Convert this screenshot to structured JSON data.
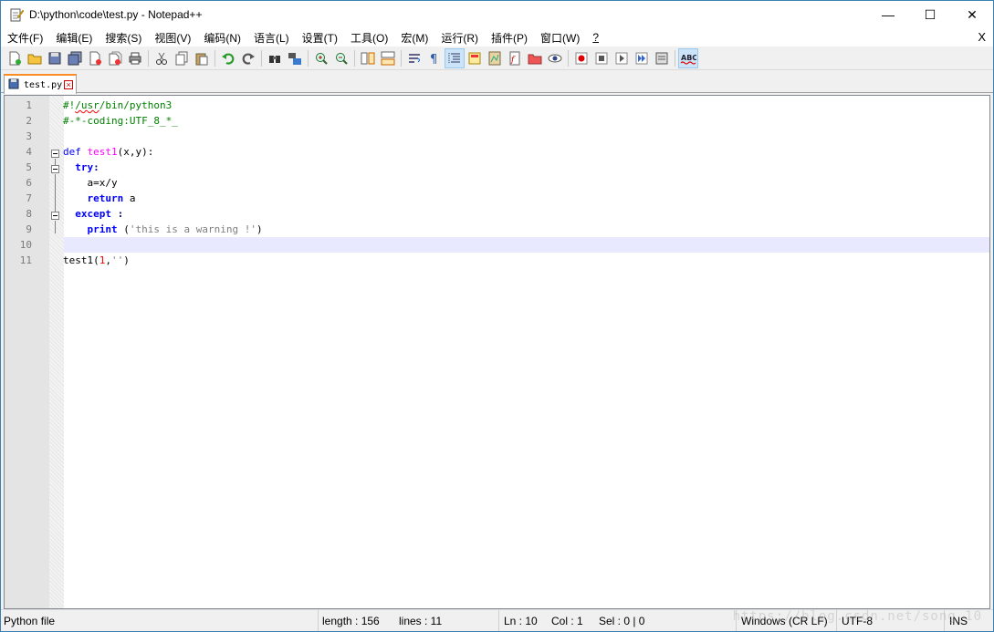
{
  "window": {
    "title": "D:\\python\\code\\test.py - Notepad++",
    "minimize": "—",
    "maximize": "☐",
    "close": "✕"
  },
  "menu": {
    "items": [
      "文件(F)",
      "编辑(E)",
      "搜索(S)",
      "视图(V)",
      "编码(N)",
      "语言(L)",
      "设置(T)",
      "工具(O)",
      "宏(M)",
      "运行(R)",
      "插件(P)",
      "窗口(W)",
      "?"
    ],
    "close_doc": "X"
  },
  "toolbar": {
    "icons": [
      "new-file-icon",
      "open-file-icon",
      "save-icon",
      "save-all-icon",
      "close-icon",
      "close-all-icon",
      "print-icon",
      "cut-icon",
      "copy-icon",
      "paste-icon",
      "undo-icon",
      "redo-icon",
      "find-icon",
      "replace-icon",
      "zoom-in-icon",
      "zoom-out-icon",
      "sync-vertical-icon",
      "sync-horizontal-icon",
      "word-wrap-icon",
      "show-all-chars-icon",
      "indent-guide-icon",
      "user-defined-lang-icon",
      "doc-map-icon",
      "function-list-icon",
      "folder-workspace-icon",
      "monitoring-icon",
      "record-macro-icon",
      "stop-record-icon",
      "playback-macro-icon",
      "run-macro-multiple-icon",
      "save-macro-icon",
      "spell-check-icon"
    ]
  },
  "tab": {
    "label": "test.py",
    "close": "×"
  },
  "editor": {
    "lines": [
      {
        "num": "1",
        "segments": [
          {
            "t": "#!",
            "c": "c-comment"
          },
          {
            "t": "/usr",
            "c": "c-comment squiggle"
          },
          {
            "t": "/bin/python3",
            "c": "c-comment"
          }
        ]
      },
      {
        "num": "2",
        "segments": [
          {
            "t": "#-*-coding:UTF_8_*_",
            "c": "c-comment"
          }
        ]
      },
      {
        "num": "3",
        "segments": []
      },
      {
        "num": "4",
        "segments": [
          {
            "t": "def ",
            "c": "c-def"
          },
          {
            "t": "test1",
            "c": "c-fn"
          },
          {
            "t": "(x,y):",
            "c": "c-plain"
          }
        ]
      },
      {
        "num": "5",
        "segments": [
          {
            "t": "  ",
            "c": "c-plain"
          },
          {
            "t": "try",
            "c": "c-kw"
          },
          {
            "t": ":",
            "c": "c-op"
          }
        ]
      },
      {
        "num": "6",
        "segments": [
          {
            "t": "    a=x/y",
            "c": "c-plain"
          }
        ]
      },
      {
        "num": "7",
        "segments": [
          {
            "t": "    ",
            "c": "c-plain"
          },
          {
            "t": "return",
            "c": "c-kw"
          },
          {
            "t": " a",
            "c": "c-plain"
          }
        ]
      },
      {
        "num": "8",
        "segments": [
          {
            "t": "  ",
            "c": "c-plain"
          },
          {
            "t": "except",
            "c": "c-kw"
          },
          {
            "t": " :",
            "c": "c-op"
          }
        ]
      },
      {
        "num": "9",
        "segments": [
          {
            "t": "    ",
            "c": "c-plain"
          },
          {
            "t": "print",
            "c": "c-kw"
          },
          {
            "t": " (",
            "c": "c-plain"
          },
          {
            "t": "'this is a warning !'",
            "c": "c-str"
          },
          {
            "t": ")",
            "c": "c-plain"
          }
        ]
      },
      {
        "num": "10",
        "segments": []
      },
      {
        "num": "11",
        "segments": [
          {
            "t": "test1(",
            "c": "c-plain"
          },
          {
            "t": "1",
            "c": "c-num"
          },
          {
            "t": ",",
            "c": "c-plain"
          },
          {
            "t": "''",
            "c": "c-str"
          },
          {
            "t": ")",
            "c": "c-plain"
          }
        ]
      }
    ],
    "current_line": 10
  },
  "status": {
    "file_type": "Python file",
    "length": "length : 156",
    "lines": "lines : 11",
    "ln": "Ln : 10",
    "col": "Col : 1",
    "sel": "Sel : 0 | 0",
    "eol": "Windows (CR LF)",
    "encoding": "UTF-8",
    "mode": "INS"
  },
  "watermark": "https://blog.csdn.net/song_10"
}
